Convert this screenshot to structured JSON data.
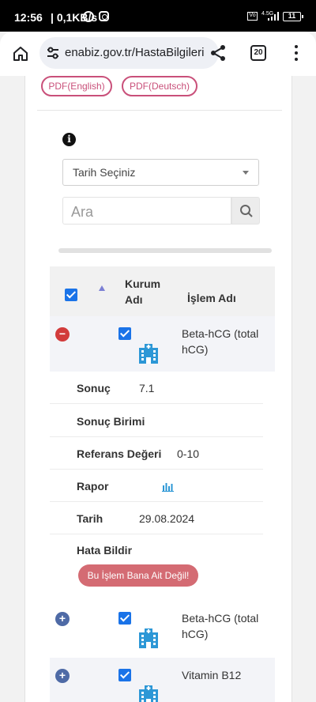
{
  "status_bar": {
    "time": "12:56",
    "speed": "0,1KB/s",
    "network": "4.5G",
    "battery": "11"
  },
  "browser": {
    "url": "enabiz.gov.tr/HastaBilgileri",
    "tab_count": "20"
  },
  "pdf_buttons": [
    "PDF(English)",
    "PDF(Deutsch)"
  ],
  "filter": {
    "date_select": "Tarih Seçiniz",
    "search_placeholder": "Ara"
  },
  "table": {
    "headers": {
      "kurum": "Kurum Adı",
      "islem": "İşlem Adı"
    },
    "rows": [
      {
        "name": "Beta-hCG (total hCG)",
        "expanded": true,
        "checked": true
      },
      {
        "name": "Beta-hCG (total hCG)",
        "expanded": false,
        "checked": true
      },
      {
        "name": "Vitamin B12",
        "expanded": false,
        "checked": true
      }
    ]
  },
  "detail": {
    "sonuc_label": "Sonuç",
    "sonuc_value": "7.1",
    "birim_label": "Sonuç Birimi",
    "birim_value": "",
    "referans_label": "Referans Değeri",
    "referans_value": "0-10",
    "rapor_label": "Rapor",
    "tarih_label": "Tarih",
    "tarih_value": "29.08.2024",
    "hata_label": "Hata Bildir",
    "hata_button": "Bu İşlem Bana Ait Değil!"
  },
  "colors": {
    "accent_pink": "#c9507a",
    "checkbox_blue": "#1a73e8",
    "error_button": "#d46b73",
    "hospital_icon": "#2c97d6"
  }
}
